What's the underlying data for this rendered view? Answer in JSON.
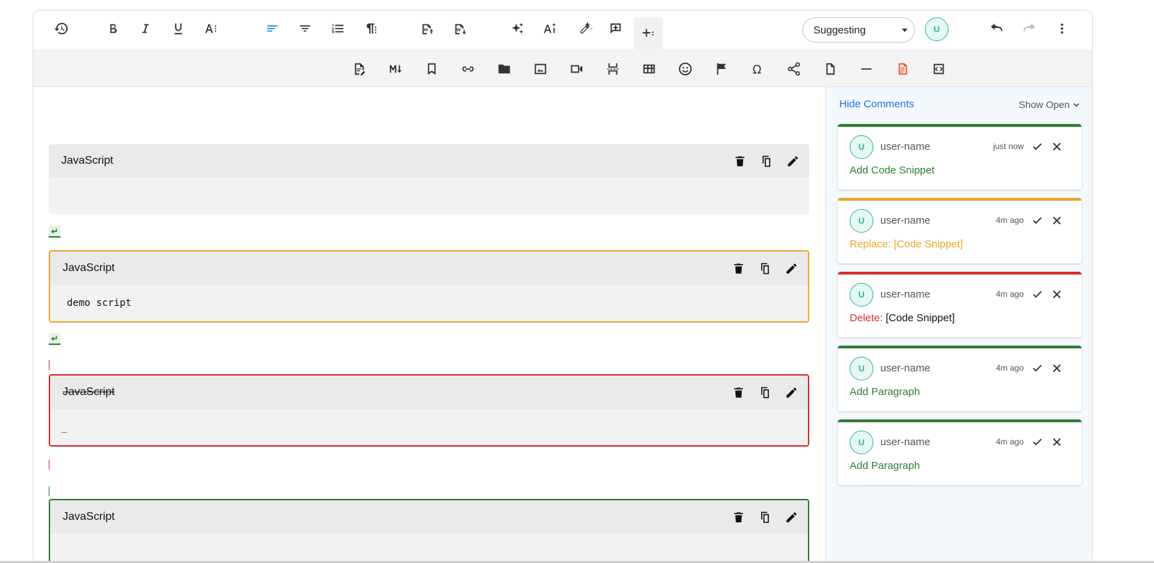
{
  "toolbar": {
    "mode_select": "Suggesting",
    "user_initial": "U",
    "row1_icons": [
      "history-icon",
      "bold-icon",
      "italic-icon",
      "underline-icon",
      "font-size-icon",
      "align-left-icon",
      "align-center-icon",
      "numbered-list-icon",
      "paragraph-icon",
      "import-word-icon",
      "export-word-icon",
      "ai-sparkle-icon",
      "ai-text-icon",
      "ai-pen-icon",
      "add-comment-icon",
      "insert-more-icon",
      "undo-icon",
      "redo-icon",
      "more-vert-icon"
    ],
    "row2_icons": [
      "document-edit-icon",
      "markdown-icon",
      "bookmark-icon",
      "link-icon",
      "folder-icon",
      "image-icon",
      "video-icon",
      "page-break-icon",
      "table-icon",
      "emoji-icon",
      "flag-icon",
      "omega-icon",
      "share-icon",
      "file-icon",
      "horizontal-rule-icon",
      "document-orange-icon",
      "code-icon"
    ]
  },
  "editor": {
    "blocks": [
      {
        "language": "JavaScript",
        "code": ""
      },
      {
        "language": "JavaScript",
        "code": "demo script"
      },
      {
        "language": "JavaScript",
        "code": "_"
      },
      {
        "language": "JavaScript",
        "code": ""
      }
    ],
    "para_mark": "↵"
  },
  "comments": {
    "hide_label": "Hide Comments",
    "show_label": "Show Open",
    "items": [
      {
        "user": "user-name",
        "initial": "U",
        "time": "just now",
        "action": "Add Code Snippet",
        "color": "#2e7d32"
      },
      {
        "user": "user-name",
        "initial": "U",
        "time": "4m ago",
        "action": "Replace: [Code Snippet]",
        "color": "#f2a32b"
      },
      {
        "user": "user-name",
        "initial": "U",
        "time": "4m ago",
        "action": "Delete:",
        "target": "[Code Snippet]",
        "color": "#d32f2f"
      },
      {
        "user": "user-name",
        "initial": "U",
        "time": "4m ago",
        "action": "Add Paragraph",
        "color": "#2e7d32"
      },
      {
        "user": "user-name",
        "initial": "U",
        "time": "4m ago",
        "action": "Add Paragraph",
        "color": "#2e7d32"
      }
    ]
  }
}
